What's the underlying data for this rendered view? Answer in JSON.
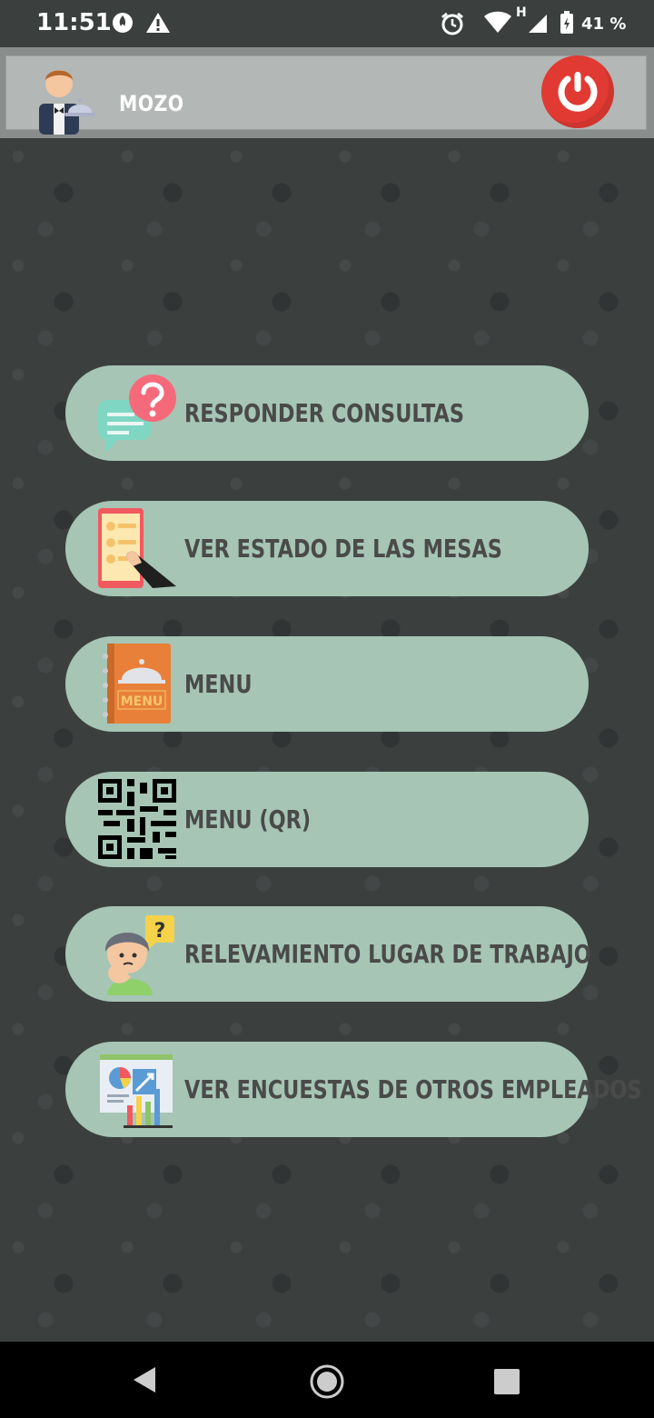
{
  "status_bar": {
    "time": "11:51",
    "network_label": "H",
    "battery": "41 %",
    "icons": [
      "flame-icon",
      "warning-icon",
      "alarm-icon",
      "wifi-icon",
      "signal-icon",
      "battery-icon"
    ]
  },
  "header": {
    "role_title": "MOZO",
    "avatar_icon": "waiter-avatar-icon",
    "power_icon": "power-icon",
    "power_color": "#e03a32"
  },
  "menu": {
    "items": [
      {
        "label": "RESPONDER CONSULTAS",
        "icon": "chat-question-icon"
      },
      {
        "label": "VER ESTADO DE LAS MESAS",
        "icon": "phone-list-icon"
      },
      {
        "label": "MENU",
        "icon": "menu-book-icon",
        "icon_text": "MENU"
      },
      {
        "label": "MENU (QR)",
        "icon": "qr-code-icon"
      },
      {
        "label": "RELEVAMIENTO LUGAR DE TRABAJO",
        "icon": "thinking-person-icon"
      },
      {
        "label": "VER ENCUESTAS DE OTROS EMPLEADOS",
        "icon": "stats-board-icon"
      }
    ],
    "button_color": "#a6c5b5"
  },
  "nav_bar": {
    "icons": [
      "back-icon",
      "home-icon",
      "recents-icon"
    ]
  },
  "colors": {
    "background": "#3b403f",
    "header": "#b3b7b6",
    "label_text": "#4a4a4a"
  }
}
